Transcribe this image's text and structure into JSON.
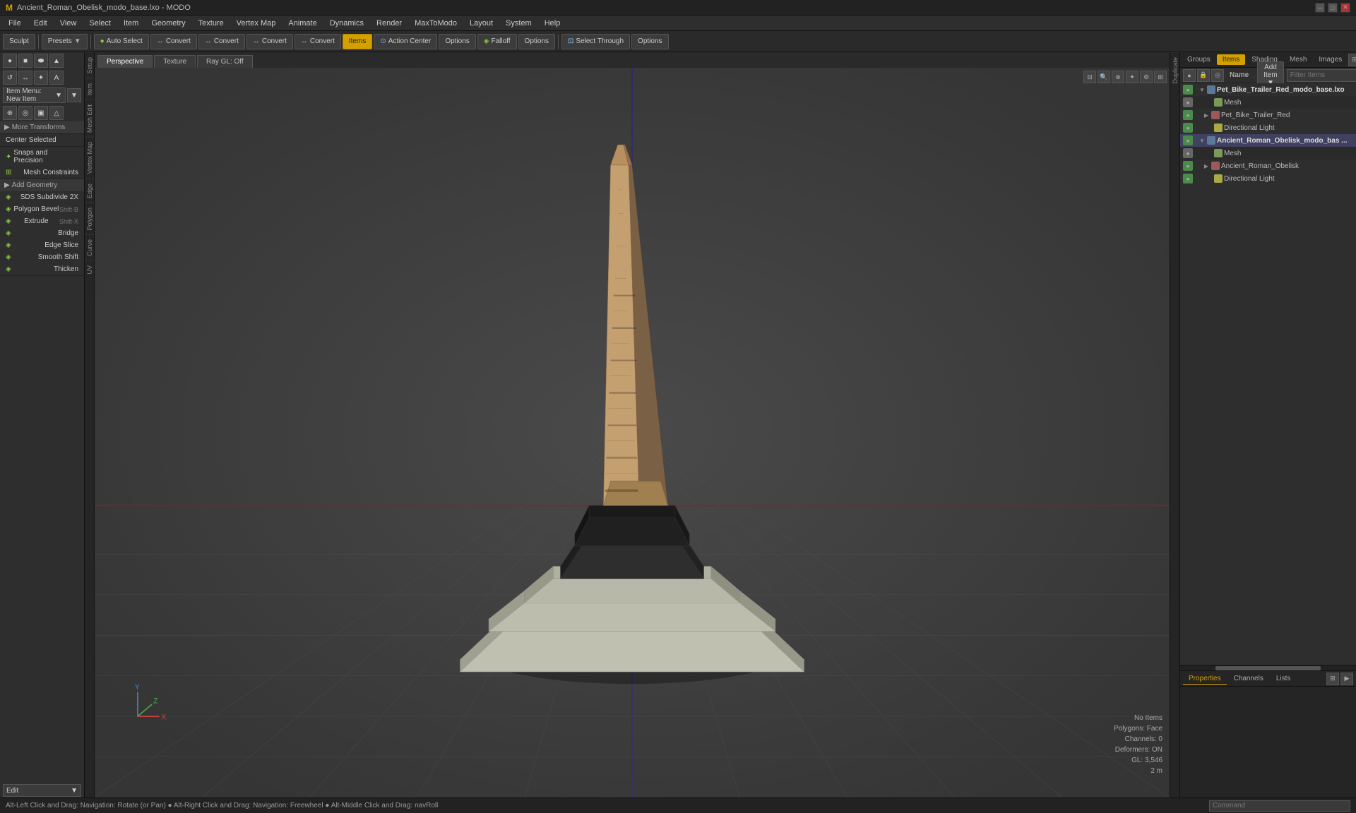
{
  "titlebar": {
    "title": "Ancient_Roman_Obelisk_modo_base.lxo - MODO",
    "controls": [
      "─",
      "□",
      "✕"
    ]
  },
  "menubar": {
    "items": [
      "File",
      "Edit",
      "View",
      "Select",
      "Item",
      "Geometry",
      "Texture",
      "Vertex Map",
      "Animate",
      "Dynamics",
      "Render",
      "MaxToModo",
      "Layout",
      "System",
      "Help"
    ]
  },
  "toolbar": {
    "sculpt_label": "Sculpt",
    "presets_label": "Presets",
    "auto_select_label": "Auto Select",
    "convert_labels": [
      "Convert",
      "Convert",
      "Convert",
      "Convert"
    ],
    "items_label": "Items",
    "action_center_label": "Action Center",
    "options_label": "Options",
    "falloff_label": "Falloff",
    "options2_label": "Options",
    "select_through_label": "Select Through",
    "options3_label": "Options"
  },
  "viewport_tabs": {
    "tabs": [
      "Perspective",
      "Texture",
      "Ray GL: Off"
    ]
  },
  "viewport": {
    "info": {
      "no_items": "No Items",
      "polygons": "Polygons: Face",
      "channels": "Channels: 0",
      "deformers": "Deformers: ON",
      "gl": "GL: 3,546",
      "scale": "2 m"
    }
  },
  "left_sidebar": {
    "item_menu": "Item Menu: New Item",
    "transforms": {
      "header": "More Transforms",
      "items": []
    },
    "center_selected": "Center Selected",
    "snaps_precision": "Snaps and Precision",
    "mesh_constraints": "Mesh Constraints",
    "add_geometry_header": "Add Geometry",
    "tools": [
      {
        "label": "SDS Subdivide 2X",
        "shortcut": ""
      },
      {
        "label": "Polygon Bevel",
        "shortcut": "Shift-B"
      },
      {
        "label": "Extrude",
        "shortcut": "Shift-X"
      },
      {
        "label": "Bridge",
        "shortcut": ""
      },
      {
        "label": "Edge Slice",
        "shortcut": ""
      },
      {
        "label": "Smooth Shift",
        "shortcut": ""
      },
      {
        "label": "Thicken",
        "shortcut": ""
      }
    ],
    "edit_label": "Edit"
  },
  "right_panel": {
    "tabs": [
      "Groups",
      "Items",
      "Shading",
      "Mesh",
      "Images"
    ],
    "add_item": "Add Item",
    "filter_placeholder": "Filter Items",
    "scene_tree": [
      {
        "id": "pet_bike_trailer_red_modo_base",
        "label": "Pet_Bike_Trailer_Red_modo_base.lxo",
        "indent": 0,
        "expanded": true,
        "type": "scene"
      },
      {
        "id": "mesh1",
        "label": "Mesh",
        "indent": 1,
        "expanded": false,
        "type": "mesh"
      },
      {
        "id": "pet_bike_trailer_red",
        "label": "Pet_Bike_Trailer_Red",
        "indent": 1,
        "expanded": false,
        "type": "group"
      },
      {
        "id": "dir_light1",
        "label": "Directional Light",
        "indent": 1,
        "expanded": false,
        "type": "light"
      },
      {
        "id": "ancient_roman_obelisk_modo_base",
        "label": "Ancient_Roman_Obelisk_modo_bas ...",
        "indent": 0,
        "expanded": true,
        "type": "scene",
        "selected": true
      },
      {
        "id": "mesh2",
        "label": "Mesh",
        "indent": 1,
        "expanded": false,
        "type": "mesh"
      },
      {
        "id": "ancient_roman_obelisk",
        "label": "Ancient_Roman_Obelisk",
        "indent": 1,
        "expanded": false,
        "type": "group"
      },
      {
        "id": "dir_light2",
        "label": "Directional Light",
        "indent": 1,
        "expanded": false,
        "type": "light"
      }
    ],
    "props_tabs": [
      "Properties",
      "Channels",
      "Lists"
    ]
  },
  "statusbar": {
    "left": "Alt-Left Click and Drag: Navigation: Rotate (or Pan) ● Alt-Right Click and Drag: Navigation: Freewheel ● Alt-Middle Click and Drag: navRoll",
    "right": "Command"
  },
  "vertical_tabs": {
    "setup": [
      "Setup",
      "Item",
      "Mesh Edit",
      "Vertex Map",
      "Edge",
      "Polygon",
      "Curve",
      "UV"
    ],
    "right": [
      "Duplicate"
    ]
  }
}
